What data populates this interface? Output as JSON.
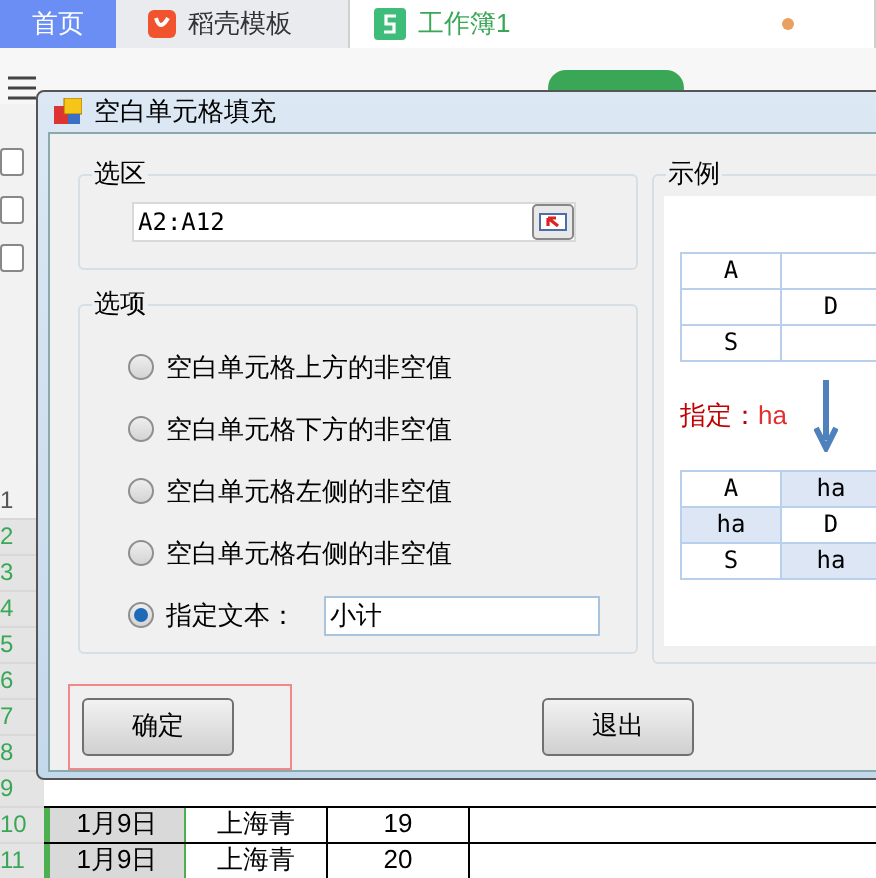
{
  "tabs": [
    {
      "label": "首页",
      "kind": "home",
      "selected": false
    },
    {
      "label": "稻壳模板",
      "kind": "docer",
      "selected": false
    },
    {
      "label": "工作簿1",
      "kind": "sheet",
      "selected": true
    }
  ],
  "side_checkboxes": [
    {
      "checked": false
    },
    {
      "checked": false
    },
    {
      "checked": false
    }
  ],
  "sheet": {
    "rows": [
      {
        "number": "1",
        "selected": false
      },
      {
        "number": "2",
        "selected": true
      },
      {
        "number": "3",
        "selected": true
      },
      {
        "number": "4",
        "selected": true
      },
      {
        "number": "5",
        "selected": true
      },
      {
        "number": "6",
        "selected": true
      },
      {
        "number": "7",
        "selected": true
      },
      {
        "number": "8",
        "selected": true
      },
      {
        "number": "9",
        "selected": true
      },
      {
        "number": "10",
        "selected": true,
        "cells": [
          "1月9日",
          "上海青",
          "19"
        ]
      },
      {
        "number": "11",
        "selected": true,
        "cells": [
          "1月9日",
          "上海青",
          "20"
        ]
      }
    ]
  },
  "dialog": {
    "title": "空白单元格填充",
    "range": {
      "label": "选区",
      "value": "A2:A12"
    },
    "options": {
      "label": "选项",
      "items": [
        {
          "kind": "radio",
          "label": "空白单元格上方的非空值",
          "selected": false
        },
        {
          "kind": "radio",
          "label": "空白单元格下方的非空值",
          "selected": false
        },
        {
          "kind": "radio",
          "label": "空白单元格左侧的非空值",
          "selected": false
        },
        {
          "kind": "radio",
          "label": "空白单元格右侧的非空值",
          "selected": false
        },
        {
          "kind": "text",
          "label": "指定文本：",
          "selected": true,
          "value": "小计"
        }
      ]
    },
    "example": {
      "label": "示例",
      "before": [
        {
          "left": "A"
        },
        {
          "right": "D"
        },
        {
          "left": "S"
        }
      ],
      "caption": "指定：",
      "caption_value": "ha",
      "after": [
        [
          {
            "text": "A",
            "filled": false
          },
          {
            "text": "ha",
            "filled": true
          }
        ],
        [
          {
            "text": "ha",
            "filled": true
          },
          {
            "text": "D",
            "filled": false
          }
        ],
        [
          {
            "text": "S",
            "filled": false
          },
          {
            "text": "ha",
            "filled": true
          }
        ]
      ]
    },
    "buttons": [
      {
        "label": "确定",
        "highlighted": true
      },
      {
        "label": "退出",
        "highlighted": false
      }
    ]
  }
}
